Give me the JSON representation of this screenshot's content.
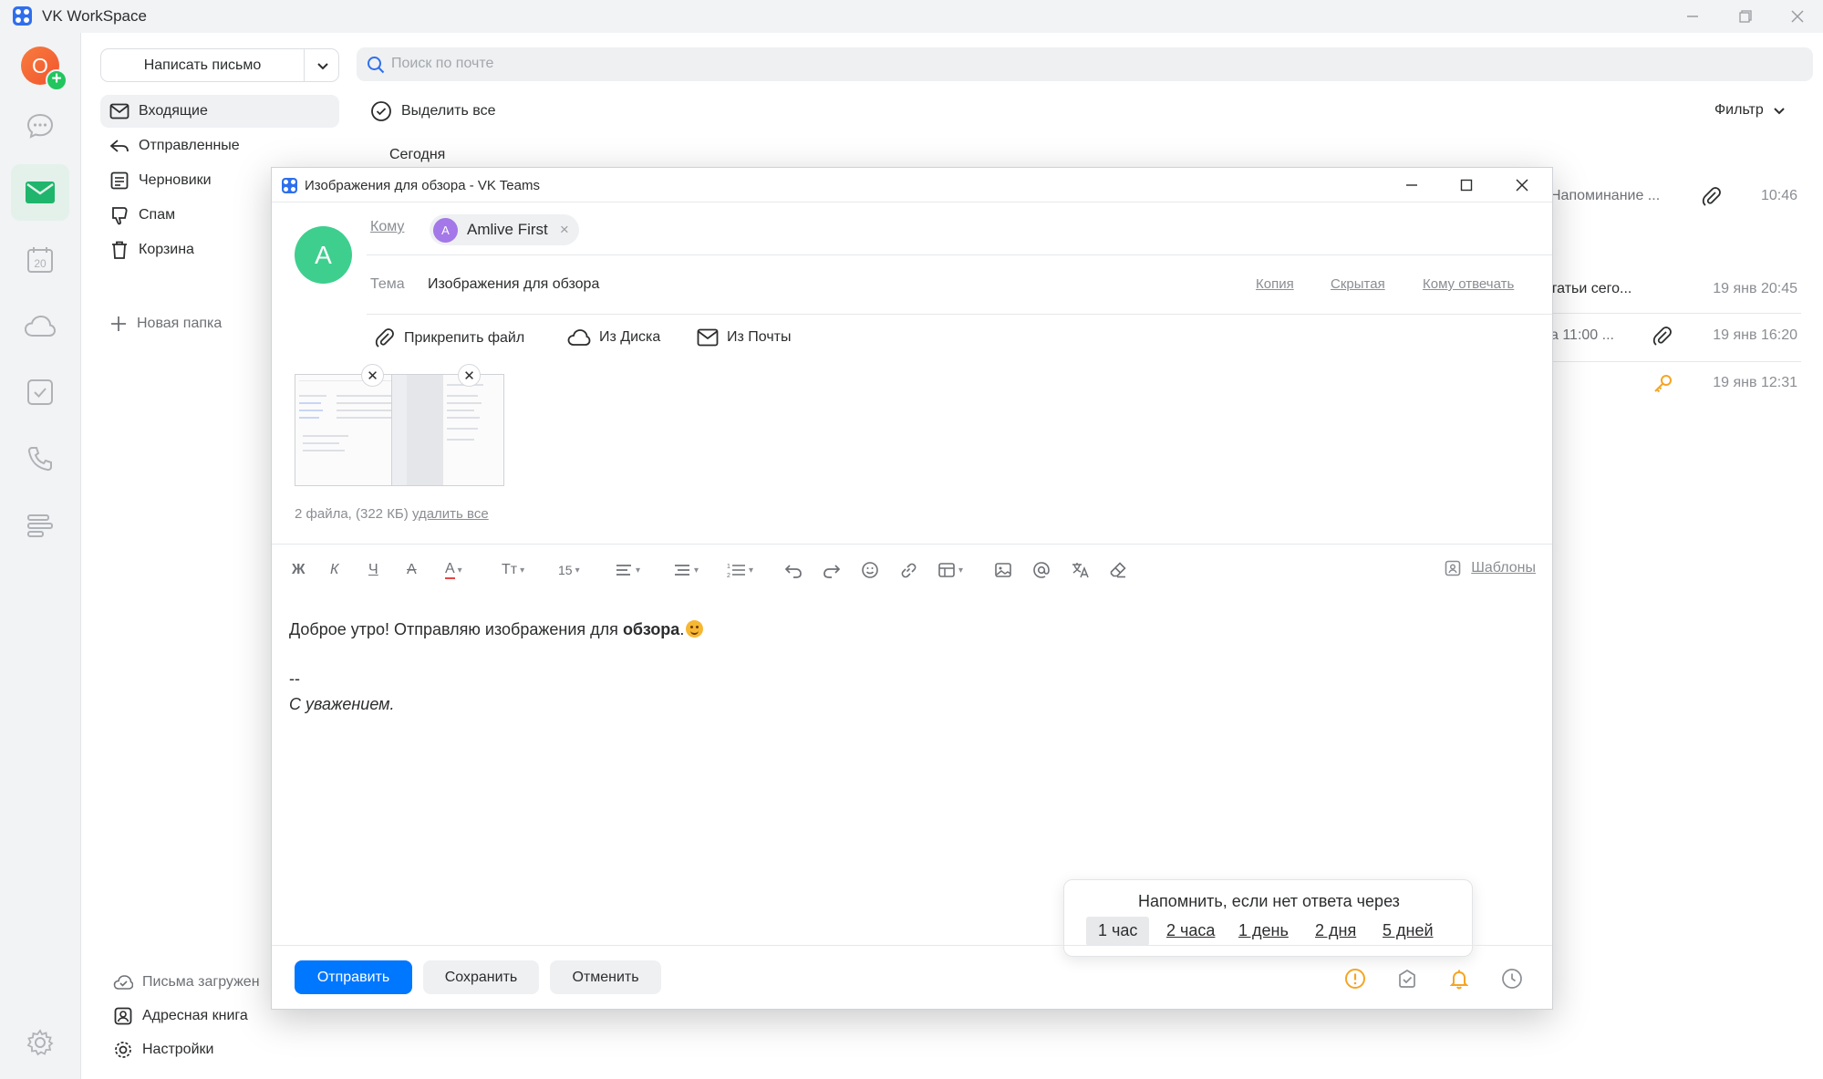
{
  "app": {
    "title": "VK WorkSpace"
  },
  "rail": {
    "avatar_letter": "O",
    "calendar_day": "20"
  },
  "sidebar": {
    "compose_label": "Написать письмо",
    "folders": [
      {
        "label": "Входящие",
        "icon": "inbox-icon",
        "active": true
      },
      {
        "label": "Отправленные",
        "icon": "sent-icon"
      },
      {
        "label": "Черновики",
        "icon": "drafts-icon"
      },
      {
        "label": "Спам",
        "icon": "spam-icon"
      },
      {
        "label": "Корзина",
        "icon": "trash-icon"
      }
    ],
    "new_folder_label": "Новая папка",
    "bottom": {
      "loading_label": "Письма загружен",
      "address_book_label": "Адресная книга",
      "settings_label": "Настройки"
    }
  },
  "mail": {
    "search_placeholder": "Поиск по почте",
    "select_all_label": "Выделить все",
    "filter_label": "Фильтр",
    "group_today": "Сегодня",
    "rows": [
      {
        "snippet": "Напоминание ...",
        "date": "10:46",
        "icon": "paperclip-icon"
      },
      {
        "snippet": "татьи   сего...",
        "date": "19 янв   20:45",
        "icon": ""
      },
      {
        "snippet": "а 11:00 ...",
        "date": "19 янв   16:20",
        "icon": "paperclip-icon"
      },
      {
        "snippet": "",
        "date": "19 янв   12:31",
        "icon": "key-icon"
      }
    ]
  },
  "compose": {
    "window_title": "Изображения для обзора - VK Teams",
    "avatar_letter": "A",
    "to_label": "Кому",
    "recipient": {
      "initial": "A",
      "name": "Amlive First"
    },
    "subject_label": "Тема",
    "subject": "Изображения для обзора",
    "cc_label": "Копия",
    "bcc_label": "Скрытая",
    "reply_to_label": "Кому отвечать",
    "attach_file_label": "Прикрепить файл",
    "from_disk_label": "Из Диска",
    "from_mail_label": "Из Почты",
    "files_info": "2 файла, (322 КБ)",
    "delete_all_label": "удалить все",
    "toolbar": {
      "bold": "Ж",
      "italic": "К",
      "underline": "Ч",
      "strike": "А",
      "color": "А",
      "font_size_icon": "Тт",
      "font_size": "15",
      "templates_label": "Шаблоны"
    },
    "body": {
      "greeting": "Доброе утро! Отправляю изображения для ",
      "bold_word": "обзора",
      "greeting_end": ".",
      "signature_dash": "--",
      "signature": "С уважением."
    },
    "reminder": {
      "title": "Напомнить, если нет ответа через",
      "options": [
        "1 час",
        "2 часа",
        "1 день",
        "2 дня",
        "5 дней"
      ],
      "selected": "1 час"
    },
    "buttons": {
      "send": "Отправить",
      "save": "Сохранить",
      "cancel": "Отменить"
    },
    "colors": {
      "primary": "#0077ff",
      "accent_green": "#1fb56c",
      "warning": "#f5a524"
    }
  }
}
